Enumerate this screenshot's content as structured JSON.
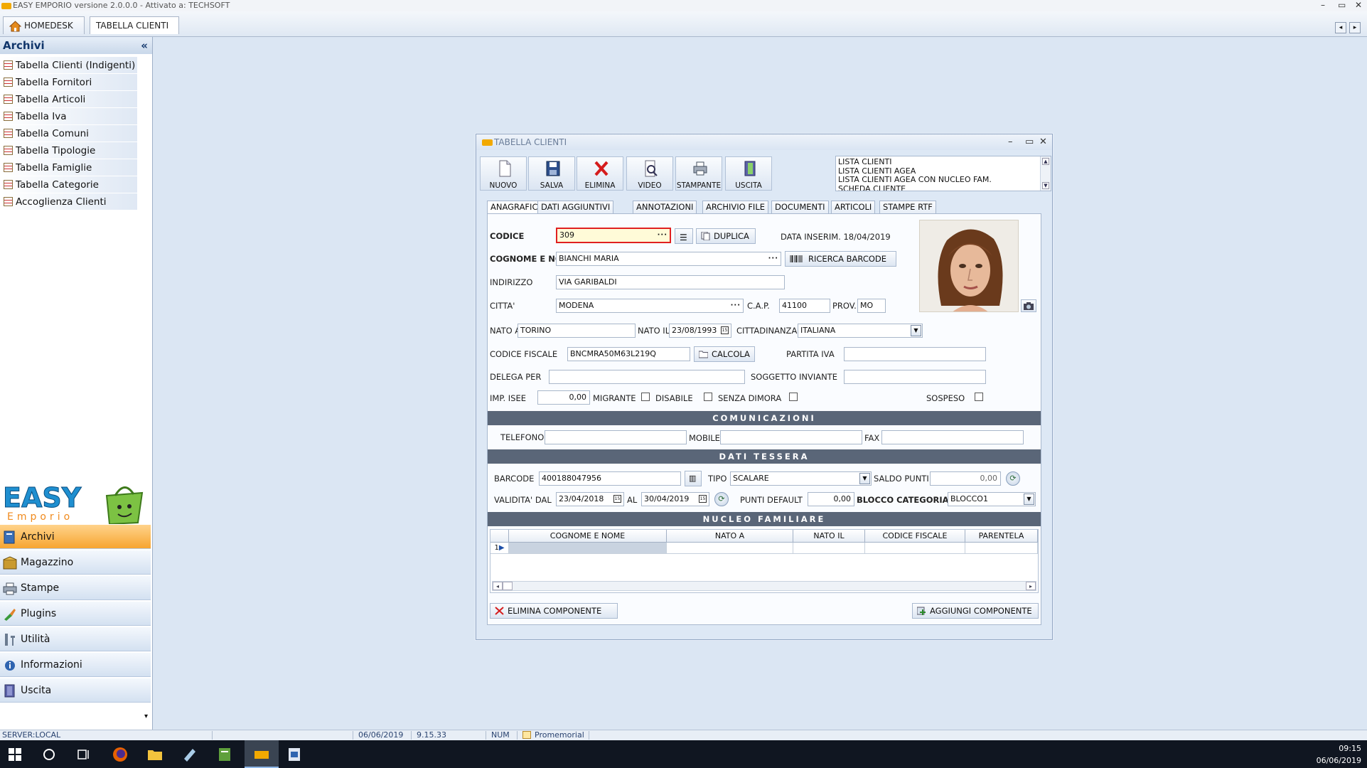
{
  "window": {
    "title": "EASY EMPORIO versione 2.0.0.0 - Attivato a: TECHSOFT",
    "min": "–",
    "max": "▭",
    "close": "✕"
  },
  "toptabs": [
    {
      "label": "HOMEDESK"
    },
    {
      "label": "TABELLA CLIENTI",
      "close": "×"
    }
  ],
  "sidebar": {
    "title": "Archivi",
    "collapse": "«",
    "items": [
      {
        "label": "Tabella Clienti (Indigenti)"
      },
      {
        "label": "Tabella Fornitori"
      },
      {
        "label": "Tabella Articoli"
      },
      {
        "label": "Tabella Iva"
      },
      {
        "label": "Tabella Comuni"
      },
      {
        "label": "Tabella Tipologie"
      },
      {
        "label": "Tabella Famiglie"
      },
      {
        "label": "Tabella Categorie"
      },
      {
        "label": "Accoglienza Clienti"
      }
    ],
    "logo_text": "EASY",
    "logo_sub": "Emporio",
    "nav": [
      {
        "label": "Archivi"
      },
      {
        "label": "Magazzino"
      },
      {
        "label": "Stampe"
      },
      {
        "label": "Plugins"
      },
      {
        "label": "Utilità"
      },
      {
        "label": "Informazioni"
      },
      {
        "label": "Uscita"
      }
    ],
    "more": "▾"
  },
  "dialog": {
    "title": "TABELLA CLIENTI",
    "toolbar": {
      "nuovo": "NUOVO",
      "salva": "SALVA",
      "elimina": "ELIMINA",
      "video": "VIDEO",
      "stampante": "STAMPANTE",
      "uscita": "USCITA"
    },
    "reports": [
      "LISTA CLIENTI",
      "LISTA CLIENTI AGEA",
      "LISTA CLIENTI AGEA CON NUCLEO FAM.",
      "SCHEDA CLIENTE"
    ],
    "tabs": [
      "ANAGRAFICA",
      "DATI AGGIUNTIVI",
      "ANNOTAZIONI",
      "ARCHIVIO FILE",
      "DOCUMENTI",
      "ARTICOLI",
      "STAMPE RTF"
    ],
    "form": {
      "codice_label": "CODICE",
      "codice": "309",
      "duplica": "DUPLICA",
      "data_inserim": "DATA INSERIM. 18/04/2019",
      "cognome_label": "COGNOME E NOME",
      "cognome": "BIANCHI MARIA",
      "ricerca_barcode": "RICERCA BARCODE",
      "indirizzo_label": "INDIRIZZO",
      "indirizzo": "VIA GARIBALDI",
      "citta_label": "CITTA'",
      "citta": "MODENA",
      "cap_label": "C.A.P.",
      "cap": "41100",
      "prov_label": "PROV.",
      "prov": "MO",
      "nato_a_label": "NATO A",
      "nato_a": "TORINO",
      "nato_il_label": "NATO IL",
      "nato_il": "23/08/1993",
      "cittadinanza_label": "CITTADINANZA",
      "cittadinanza": "ITALIANA",
      "cf_label": "CODICE FISCALE",
      "cf": "BNCMRA50M63L219Q",
      "calcola": "CALCOLA",
      "piva_label": "PARTITA IVA",
      "piva": "",
      "delega_label": "DELEGA PER",
      "delega": "",
      "soggetto_label": "SOGGETTO INVIANTE",
      "soggetto": "",
      "isee_label": "IMP. ISEE",
      "isee": "0,00",
      "migrante_label": "MIGRANTE",
      "disabile_label": "DISABILE",
      "senza_dimora_label": "SENZA DIMORA",
      "sospeso_label": "SOSPESO"
    },
    "sections": {
      "comunicazioni": "COMUNICAZIONI",
      "dati_tessera": "DATI TESSERA",
      "nucleo": "NUCLEO FAMILIARE"
    },
    "comm": {
      "telefono_label": "TELEFONO",
      "telefono": "",
      "mobile_label": "MOBILE",
      "mobile": "",
      "fax_label": "FAX",
      "fax": ""
    },
    "tessera": {
      "barcode_label": "BARCODE",
      "barcode": "400188047956",
      "tipo_label": "TIPO",
      "tipo": "SCALARE",
      "saldo_label": "SALDO PUNTI",
      "saldo": "0,00",
      "validita_label": "VALIDITA' DAL",
      "dal": "23/04/2018",
      "al_label": "AL",
      "al": "30/04/2019",
      "punti_label": "PUNTI DEFAULT",
      "punti": "0,00",
      "blocco_label": "BLOCCO CATEGORIA",
      "blocco": "BLOCCO1"
    },
    "grid": {
      "columns": [
        "COGNOME E NOME",
        "NATO A",
        "NATO IL",
        "CODICE FISCALE",
        "PARENTELA"
      ],
      "row_index": "1"
    },
    "elimina_componente": "ELIMINA COMPONENTE",
    "aggiungi_componente": "AGGIUNGI COMPONENTE"
  },
  "statusbar": {
    "server": "SERVER:LOCAL",
    "date": "06/06/2019",
    "time": "9.15.33",
    "num": "NUM",
    "promemoria": "Promemorial"
  },
  "taskbar": {
    "time": "09:15",
    "date": "06/06/2019"
  }
}
